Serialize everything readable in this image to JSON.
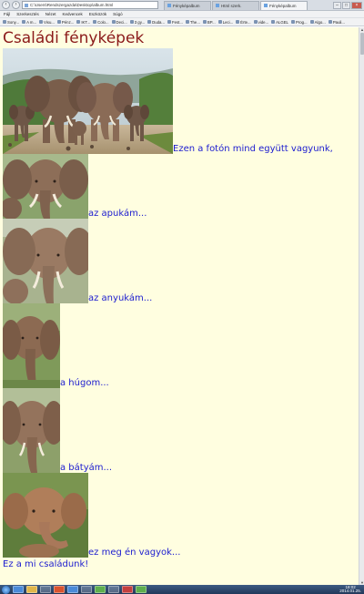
{
  "browser": {
    "address": "C:\\Users\\Rendszergazda\\Desktop\\album.html",
    "tabs": [
      {
        "label": "Fényképalbum",
        "active": false
      },
      {
        "label": "Html szerk.",
        "active": false
      },
      {
        "label": "Fényképalbum",
        "active": true
      }
    ],
    "menu": [
      "Fájl",
      "Szerkesztés",
      "Nézet",
      "Kedvencek",
      "Eszközök",
      "Súgó"
    ],
    "bookmarks": [
      "Sony...",
      "A m...",
      "Visu...",
      "Pénz...",
      "IKT...",
      "Colo...",
      "Deci...",
      "3 gy...",
      "Duda...",
      "Fest...",
      "The...",
      "BP...",
      "Leci...",
      "Érte...",
      "vide...",
      "ALGEL",
      "Prog...",
      "Algo...",
      "Pauli..."
    ]
  },
  "page": {
    "title": "Családi fényképek",
    "photos": [
      {
        "caption": "Ezen a fotón mind együtt vagyunk,",
        "alt": "elephant family"
      },
      {
        "caption": "az apukám...",
        "alt": "father elephant"
      },
      {
        "caption": "az anyukám...",
        "alt": "mother elephant"
      },
      {
        "caption": "a húgom...",
        "alt": "young elephant"
      },
      {
        "caption": "a bátyám...",
        "alt": "older brother elephant"
      },
      {
        "caption": "ez meg én vagyok...",
        "alt": "baby elephant"
      }
    ],
    "closing": "Ez a mi családunk!"
  },
  "taskbar": {
    "time": "18:02",
    "date": "2014.01.25."
  },
  "colors": {
    "page_background": "#fffee0",
    "title": "#8b1a1a",
    "caption": "#1c1ccf"
  }
}
